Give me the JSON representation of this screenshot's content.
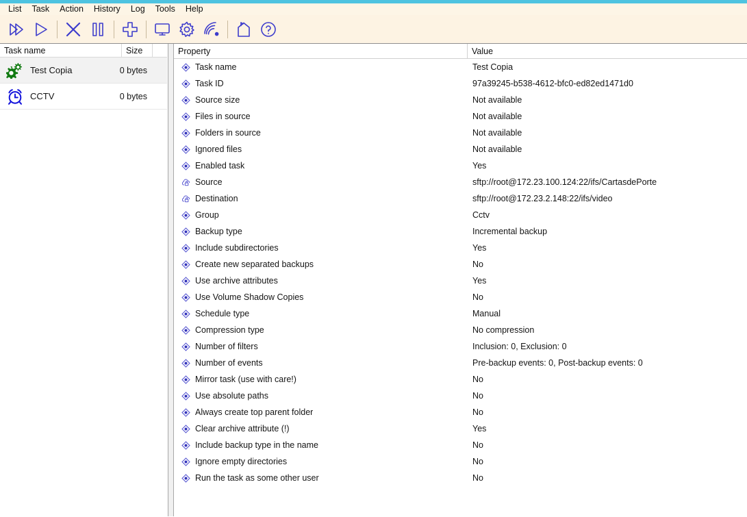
{
  "menubar": {
    "items": [
      {
        "label": "List"
      },
      {
        "label": "Task"
      },
      {
        "label": "Action"
      },
      {
        "label": "History"
      },
      {
        "label": "Log"
      },
      {
        "label": "Tools"
      },
      {
        "label": "Help"
      }
    ]
  },
  "toolbar": {
    "icon_color": "#3d3ccc",
    "buttons": [
      {
        "name": "run-all-tasks-button",
        "icon": "double-play-icon"
      },
      {
        "name": "run-task-button",
        "icon": "play-icon"
      },
      {
        "name": "stop-task-button",
        "icon": "stop-x-icon"
      },
      {
        "name": "pause-task-button",
        "icon": "pause-icon"
      },
      {
        "name": "add-task-button",
        "icon": "plus-icon"
      },
      {
        "name": "monitor-button",
        "icon": "monitor-icon"
      },
      {
        "name": "settings-button",
        "icon": "gear-icon"
      },
      {
        "name": "network-button",
        "icon": "wifi-icon"
      },
      {
        "name": "home-button",
        "icon": "home-icon"
      },
      {
        "name": "help-button",
        "icon": "question-circle-icon"
      }
    ]
  },
  "tasklist": {
    "columns": [
      "Task name",
      "Size",
      ""
    ],
    "rows": [
      {
        "icon": "green-gears-icon",
        "name": "Test Copia",
        "size": "0 bytes",
        "selected": true
      },
      {
        "icon": "blue-alarm-clock-icon",
        "name": "CCTV",
        "size": "0 bytes",
        "selected": false
      }
    ]
  },
  "properties": {
    "columns": [
      "Property",
      "Value"
    ],
    "rows": [
      {
        "icon": "property-dot-icon",
        "label": "Task name",
        "value": "Test Copia"
      },
      {
        "icon": "property-dot-icon",
        "label": "Task ID",
        "value": "97a39245-b538-4612-bfc0-ed82ed1471d0"
      },
      {
        "icon": "property-dot-icon",
        "label": "Source size",
        "value": "Not available"
      },
      {
        "icon": "property-dot-icon",
        "label": "Files in source",
        "value": "Not available"
      },
      {
        "icon": "property-dot-icon",
        "label": "Folders in source",
        "value": "Not available"
      },
      {
        "icon": "property-dot-icon",
        "label": "Ignored files",
        "value": "Not available"
      },
      {
        "icon": "property-dot-icon",
        "label": "Enabled task",
        "value": "Yes"
      },
      {
        "icon": "cloud-lock-icon",
        "label": "Source",
        "value": "sftp://root@172.23.100.124:22/ifs/CartasdePorte"
      },
      {
        "icon": "cloud-lock-icon",
        "label": "Destination",
        "value": "sftp://root@172.23.2.148:22/ifs/video"
      },
      {
        "icon": "property-dot-icon",
        "label": "Group",
        "value": "Cctv"
      },
      {
        "icon": "property-dot-icon",
        "label": "Backup type",
        "value": "Incremental backup"
      },
      {
        "icon": "property-dot-icon",
        "label": "Include subdirectories",
        "value": "Yes"
      },
      {
        "icon": "property-dot-icon",
        "label": "Create new separated backups",
        "value": "No"
      },
      {
        "icon": "property-dot-icon",
        "label": "Use archive attributes",
        "value": "Yes"
      },
      {
        "icon": "property-dot-icon",
        "label": "Use Volume Shadow Copies",
        "value": "No"
      },
      {
        "icon": "property-dot-icon",
        "label": "Schedule type",
        "value": "Manual"
      },
      {
        "icon": "property-dot-icon",
        "label": "Compression type",
        "value": "No compression"
      },
      {
        "icon": "property-dot-icon",
        "label": "Number of filters",
        "value": "Inclusion: 0, Exclusion: 0"
      },
      {
        "icon": "property-dot-icon",
        "label": "Number of events",
        "value": "Pre-backup events: 0, Post-backup events: 0"
      },
      {
        "icon": "property-dot-icon",
        "label": "Mirror task (use with care!)",
        "value": "No"
      },
      {
        "icon": "property-dot-icon",
        "label": "Use absolute paths",
        "value": "No"
      },
      {
        "icon": "property-dot-icon",
        "label": "Always create top parent folder",
        "value": "No"
      },
      {
        "icon": "property-dot-icon",
        "label": "Clear archive attribute (!)",
        "value": "Yes"
      },
      {
        "icon": "property-dot-icon",
        "label": "Include backup type in the name",
        "value": "No"
      },
      {
        "icon": "property-dot-icon",
        "label": "Ignore empty directories",
        "value": "No"
      },
      {
        "icon": "property-dot-icon",
        "label": "Run the task as some other user",
        "value": "No"
      }
    ]
  }
}
